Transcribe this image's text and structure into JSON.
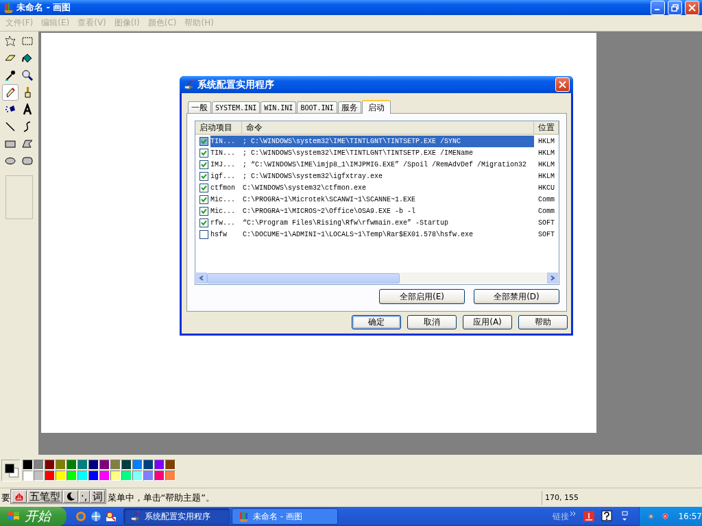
{
  "window": {
    "title": "未命名 - 画图"
  },
  "menu": [
    {
      "label": "文件(F)",
      "disabled": true
    },
    {
      "label": "编辑(E)",
      "disabled": true
    },
    {
      "label": "查看(V)",
      "disabled": true
    },
    {
      "label": "图像(I)",
      "disabled": true
    },
    {
      "label": "颜色(C)",
      "disabled": true
    },
    {
      "label": "帮助(H)",
      "disabled": true
    }
  ],
  "tools": [
    {
      "kind": "free-select",
      "selected": false
    },
    {
      "kind": "rect-select",
      "selected": false
    },
    {
      "kind": "eraser",
      "selected": false
    },
    {
      "kind": "fill",
      "selected": false
    },
    {
      "kind": "picker",
      "selected": false
    },
    {
      "kind": "magnifier",
      "selected": false
    },
    {
      "kind": "pencil",
      "selected": true
    },
    {
      "kind": "brush",
      "selected": false
    },
    {
      "kind": "airbrush",
      "selected": false
    },
    {
      "kind": "text",
      "selected": false
    },
    {
      "kind": "line",
      "selected": false
    },
    {
      "kind": "curve",
      "selected": false
    },
    {
      "kind": "rectangle",
      "selected": false
    },
    {
      "kind": "polygon",
      "selected": false
    },
    {
      "kind": "ellipse",
      "selected": false
    },
    {
      "kind": "rounded-rect",
      "selected": false
    }
  ],
  "dialog": {
    "title": "系统配置实用程序",
    "tabs": [
      {
        "label": "一般",
        "selected": false
      },
      {
        "label": "SYSTEM.INI",
        "selected": false
      },
      {
        "label": "WIN.INI",
        "selected": false
      },
      {
        "label": "BOOT.INI",
        "selected": false
      },
      {
        "label": "服务",
        "selected": false
      },
      {
        "label": "启动",
        "selected": true
      }
    ],
    "table": {
      "columns": [
        "启动项目",
        "命令",
        "位置"
      ],
      "rows": [
        {
          "checked": true,
          "selected": true,
          "name": "TIN...",
          "command": "; C:\\WINDOWS\\system32\\IME\\TINTLGNT\\TINTSETP.EXE /SYNC",
          "location": "HKLM"
        },
        {
          "checked": true,
          "selected": false,
          "name": "TIN...",
          "command": "; C:\\WINDOWS\\system32\\IME\\TINTLGNT\\TINTSETP.EXE /IMEName",
          "location": "HKLM"
        },
        {
          "checked": true,
          "selected": false,
          "name": "IMJ...",
          "command": "; “C:\\WINDOWS\\IME\\imjp8_1\\IMJPMIG.EXE” /Spoil /RemAdvDef /Migration32",
          "location": "HKLM"
        },
        {
          "checked": true,
          "selected": false,
          "name": "igf...",
          "command": "; C:\\WINDOWS\\system32\\igfxtray.exe",
          "location": "HKLM"
        },
        {
          "checked": true,
          "selected": false,
          "name": "ctfmon",
          "command": "C:\\WINDOWS\\system32\\ctfmon.exe",
          "location": "HKCU"
        },
        {
          "checked": true,
          "selected": false,
          "name": "Mic...",
          "command": "C:\\PROGRA~1\\Microtek\\SCANWI~1\\SCANNE~1.EXE",
          "location": "Comm"
        },
        {
          "checked": true,
          "selected": false,
          "name": "Mic...",
          "command": "C:\\PROGRA~1\\MICROS~2\\Office\\OSA9.EXE -b -l",
          "location": "Comm"
        },
        {
          "checked": true,
          "selected": false,
          "name": "rfw...",
          "command": "“C:\\Program Files\\Rising\\Rfw\\rfwmain.exe” -Startup",
          "location": "SOFT"
        },
        {
          "checked": false,
          "selected": false,
          "name": "hsfw",
          "command": "C:\\DOCUME~1\\ADMINI~1\\LOCALS~1\\Temp\\Rar$EX01.578\\hsfw.exe",
          "location": "SOFT"
        }
      ]
    },
    "list_buttons": [
      "全部启用(E)",
      "全部禁用(D)"
    ],
    "buttons": [
      {
        "label": "确定",
        "default": true
      },
      {
        "label": "取消",
        "default": false
      },
      {
        "label": "应用(A)",
        "default": false
      },
      {
        "label": "帮助",
        "default": false
      }
    ]
  },
  "palette": {
    "current": [
      {
        "color": "#000000"
      },
      {
        "color": "#ffffff"
      }
    ],
    "colors": [
      {
        "color": "#000000"
      },
      {
        "color": "#808080"
      },
      {
        "color": "#800000"
      },
      {
        "color": "#808000"
      },
      {
        "color": "#008000"
      },
      {
        "color": "#008080"
      },
      {
        "color": "#000080"
      },
      {
        "color": "#800080"
      },
      {
        "color": "#808040"
      },
      {
        "color": "#004040"
      },
      {
        "color": "#0080ff"
      },
      {
        "color": "#004080"
      },
      {
        "color": "#8000ff"
      },
      {
        "color": "#804000"
      },
      {
        "color": "#ffffff"
      },
      {
        "color": "#c0c0c0"
      },
      {
        "color": "#ff0000"
      },
      {
        "color": "#ffff00"
      },
      {
        "color": "#00ff00"
      },
      {
        "color": "#00ffff"
      },
      {
        "color": "#0000ff"
      },
      {
        "color": "#ff00ff"
      },
      {
        "color": "#ffff80"
      },
      {
        "color": "#00ff80"
      },
      {
        "color": "#80ffff"
      },
      {
        "color": "#8080ff"
      },
      {
        "color": "#ff0080"
      },
      {
        "color": "#ff8040"
      }
    ]
  },
  "status_bar": {
    "text_before": "要",
    "ime": {
      "mode": "五笔型",
      "punct": "·,",
      "word": "词"
    },
    "text_after": "菜单中，单击“帮助主题”。",
    "coords": "170, 155"
  },
  "taskbar": {
    "start": "开始",
    "tasks": [
      {
        "label": "系统配置实用程序",
        "selected": true
      },
      {
        "label": "未命名 - 画图",
        "selected": false
      }
    ],
    "links": "链接",
    "clock": "16:57"
  }
}
